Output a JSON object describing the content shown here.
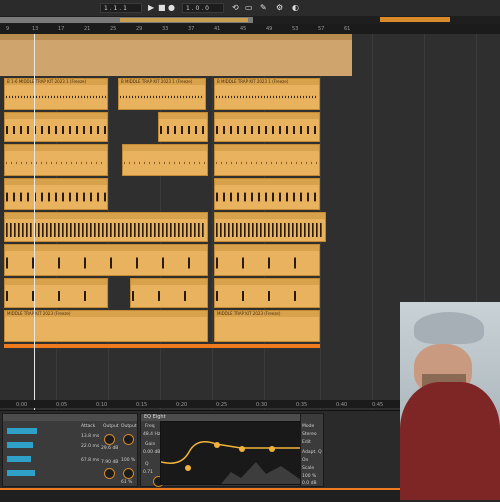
{
  "transport": {
    "tempo": "1 . 1 . 1",
    "position": "1 . 0 . 0",
    "play_icon": "play-icon",
    "stop_icon": "stop-icon",
    "record_icon": "record-icon"
  },
  "ruler": {
    "bars": [
      "9",
      "13",
      "17",
      "21",
      "25",
      "29",
      "33",
      "37",
      "41",
      "45",
      "49",
      "53",
      "57",
      "61"
    ]
  },
  "arrangement": {
    "clips": [
      {
        "label": "B 1-6 MIDDLE TRAP KIT 2023 1 (Freeze)"
      },
      {
        "label": "B MIDDLE TRAP KIT 2023 1 (Freeze)"
      },
      {
        "label": "B MIDDLE TRAP KIT 2023 1 (Freeze)"
      },
      {
        "label": "MIDDLE TRAP KIT 2023 (Freeze)"
      },
      {
        "label": "MIDDLE TRAP KIT 2023 (Freeze)"
      }
    ]
  },
  "bottom_ruler": {
    "times": [
      "0:00",
      "0:05",
      "0:10",
      "0:15",
      "0:20",
      "0:25",
      "0:30",
      "0:35",
      "0:40",
      "0:45"
    ]
  },
  "devices": {
    "compressor": {
      "labels": [
        "Attack",
        "Release",
        "Output",
        "Output"
      ],
      "values": [
        "13.8 ms",
        "29.6 dB",
        "22.0 ms",
        "7.90 dB",
        "100 %",
        "67.8 ms",
        "61 %"
      ],
      "knob_labels": [
        "Thres",
        "Ratio",
        "Amount",
        "Dry/Wet"
      ]
    },
    "eq": {
      "title": "EQ Eight",
      "freq_label": "Freq",
      "freq_value": "48.4 Hz",
      "gain_label": "Gain",
      "gain_value": "0.00 dB",
      "q_label": "Q",
      "q_value": "0.71",
      "right_labels": [
        "Mode",
        "Stereo",
        "Edit",
        "Adapt. Q",
        "Scale",
        "Gain"
      ],
      "right_values": [
        "Stereo",
        "On",
        "100 %",
        "0.0 dB"
      ]
    }
  },
  "colors": {
    "clip": "#e9b25e",
    "accent": "#f07a1e",
    "background": "#2f2f2f"
  }
}
